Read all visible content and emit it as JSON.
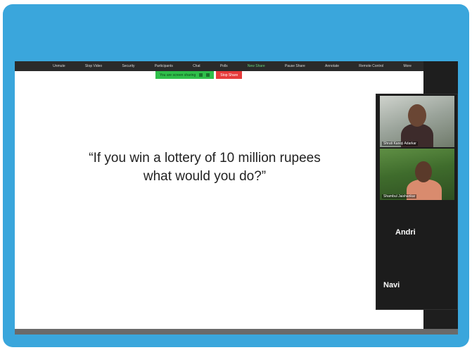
{
  "toolbar": {
    "items": [
      {
        "label": "Unmute",
        "active": false
      },
      {
        "label": "Stop Video",
        "active": false
      },
      {
        "label": "Security",
        "active": false
      },
      {
        "label": "Participants",
        "active": false
      },
      {
        "label": "Chat",
        "active": false
      },
      {
        "label": "Polls",
        "active": false
      },
      {
        "label": "New Share",
        "active": true
      },
      {
        "label": "Pause Share",
        "active": false
      },
      {
        "label": "Annotate",
        "active": false
      },
      {
        "label": "Remote Control",
        "active": false
      },
      {
        "label": "More",
        "active": false
      }
    ]
  },
  "share_bar": {
    "status": "You are screen sharing",
    "stop_label": "Stop Share",
    "green_color": "#2fbf4a",
    "red_color": "#e63b3b"
  },
  "slide": {
    "line1": "“If you win a lottery of 10 million rupees",
    "line2": "what would you do?”"
  },
  "participants": [
    {
      "name": "Shruti Kanoji Adarkar",
      "video": true
    },
    {
      "name": "Shambul Jaishankar",
      "video": true
    },
    {
      "name": "Andri",
      "video": false
    },
    {
      "name": "Navi",
      "video": false
    }
  ],
  "colors": {
    "frame": "#3aa6dc"
  }
}
